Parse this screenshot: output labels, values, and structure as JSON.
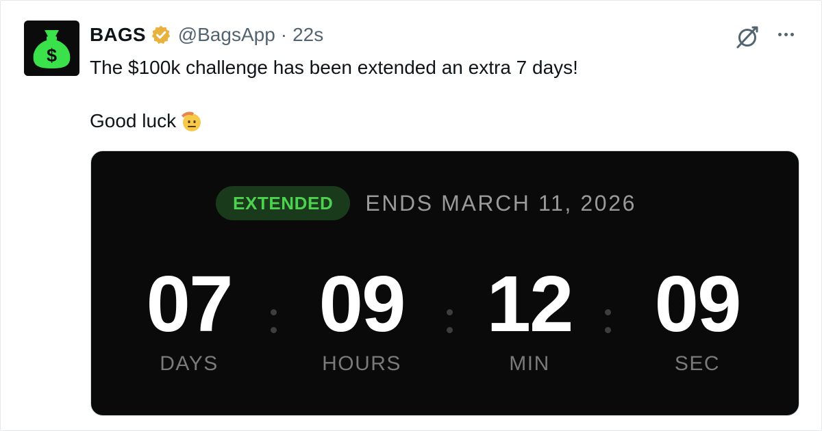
{
  "tweet": {
    "author_name": "BAGS",
    "author_handle": "@BagsApp",
    "separator": "·",
    "time": "22s",
    "avatar_glyph": "$",
    "text_line1": "The $100k challenge has been extended an extra 7 days!",
    "text_line2": "Good luck",
    "emoji": "saluting-face",
    "icons": [
      "verified-badge-icon",
      "grok-icon",
      "more-icon",
      "money-bag-icon"
    ]
  },
  "card": {
    "badge": "EXTENDED",
    "ends": "ENDS MARCH 11, 2026",
    "countdown": [
      {
        "value": "07",
        "label": "DAYS"
      },
      {
        "value": "09",
        "label": "HOURS"
      },
      {
        "value": "12",
        "label": "MIN"
      },
      {
        "value": "09",
        "label": "SEC"
      }
    ]
  },
  "colors": {
    "badge_text": "#4dd24f",
    "badge_bg": "#1a3a1c",
    "avatar_bg": "#0b0b0b",
    "avatar_bag": "#3be14a",
    "verified": "#e8b23f"
  }
}
